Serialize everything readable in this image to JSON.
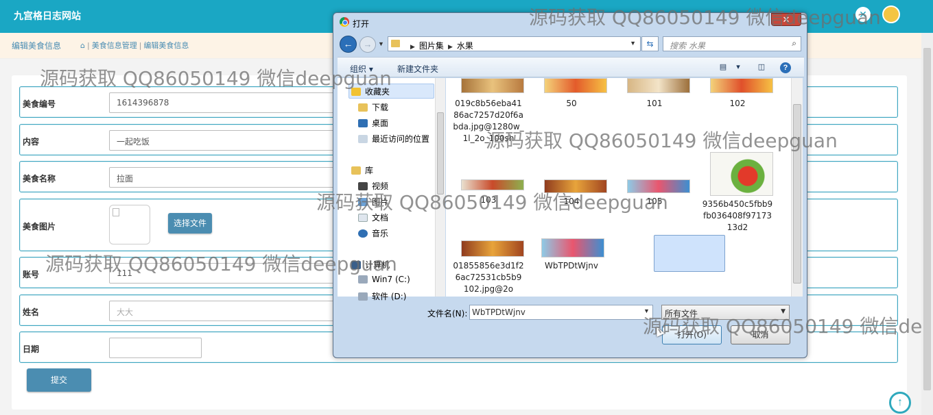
{
  "app": {
    "brand": "九宫格日志网站",
    "page_title": "编辑美食信息",
    "breadcrumbs": [
      "美食信息管理",
      "编辑美食信息"
    ]
  },
  "form": {
    "fields": [
      {
        "label": "美食编号",
        "value": "1614396878"
      },
      {
        "label": "内容",
        "value": "一起吃饭"
      },
      {
        "label": "美食名称",
        "value": "拉面"
      },
      {
        "label": "美食图片",
        "value": ""
      },
      {
        "label": "账号",
        "value": "111"
      },
      {
        "label": "姓名",
        "value": "大大"
      },
      {
        "label": "日期",
        "value": ""
      }
    ],
    "choose_file_label": "选择文件",
    "submit_label": "提交"
  },
  "dialog": {
    "title": "打开",
    "close": "✕",
    "path": [
      "图片集",
      "水果"
    ],
    "search_placeholder": "搜索 水果",
    "toolbar": {
      "organize": "组织 ▾",
      "new_folder": "新建文件夹"
    },
    "nav": {
      "favorites": "收藏夹",
      "downloads": "下载",
      "desktop": "桌面",
      "recent": "最近访问的位置",
      "libraries": "库",
      "videos": "视频",
      "pictures": "图片",
      "documents": "文档",
      "music": "音乐",
      "computer": "计算机",
      "drive_c": "Win7 (C:)",
      "drive_d": "软件 (D:)"
    },
    "files": [
      {
        "name": "019c8b56eba4186ac7257d20f6abda.jpg@1280w_1l_2o_100sh"
      },
      {
        "name": "50"
      },
      {
        "name": "101"
      },
      {
        "name": "102"
      },
      {
        "name": "103"
      },
      {
        "name": "104"
      },
      {
        "name": "105"
      },
      {
        "name": "9356b450c5fbb9fb036408f9717313d2"
      },
      {
        "name": "01855856e3d1f26ac72531cb5b9102.jpg@2o"
      },
      {
        "name": "WbTPDtWjnv"
      }
    ],
    "filename_label": "文件名(N):",
    "filename_value": "WbTPDtWjnv",
    "filetype_value": "所有文件",
    "open_label": "打开(O)",
    "cancel_label": "取消"
  },
  "watermarks": [
    "源码获取 QQ86050149 微信deepguan",
    "源码获取 QQ86050149 微信deepguan",
    "源码获取 QQ86050149 微信deepguan",
    "源码获取 QQ86050149 微信deepguan",
    "源码获取 QQ86050149 微信deepguan",
    "源码获取 QQ86050149 微信de"
  ],
  "colors": {
    "header": "#1aa7c4",
    "button": "#4b8db1",
    "row_border": "#3fa6c0"
  }
}
